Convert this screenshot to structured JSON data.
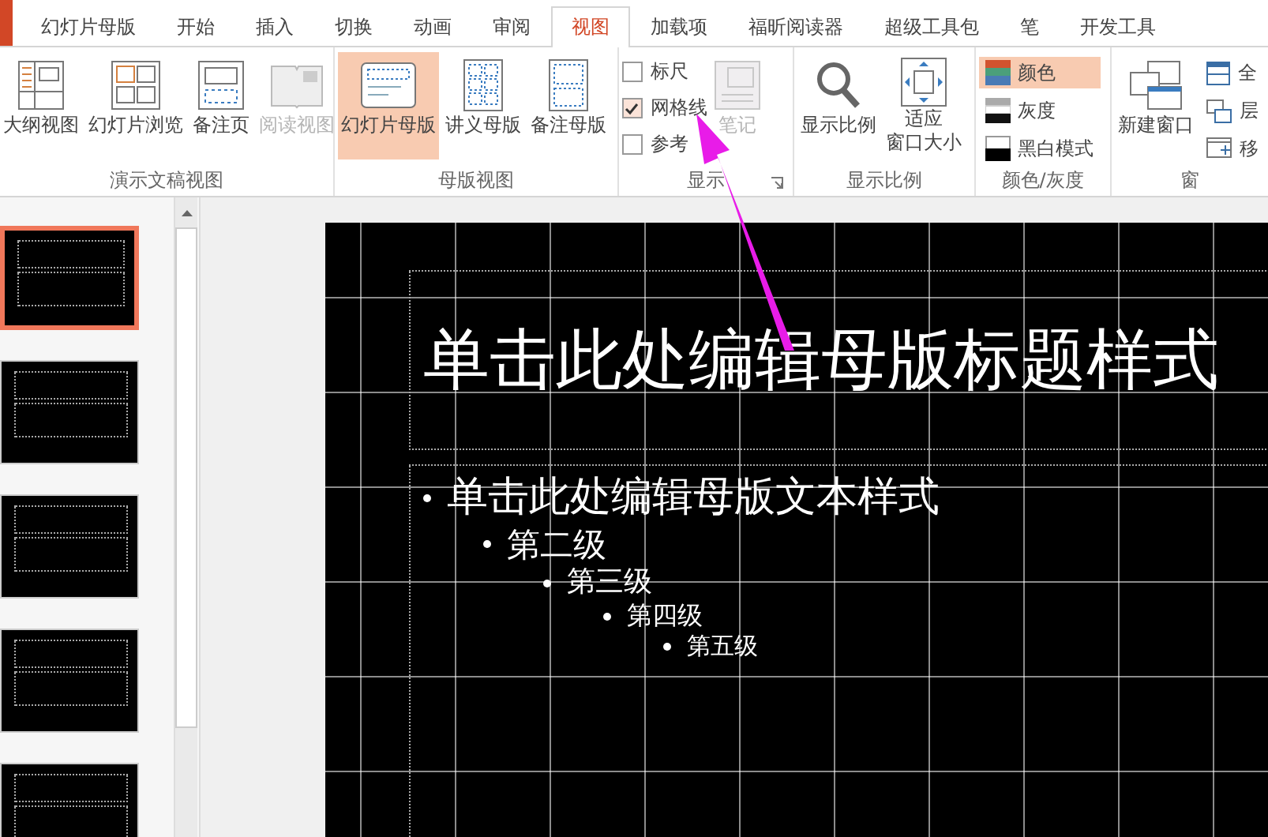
{
  "tabs": [
    {
      "label": "幻灯片母版",
      "selected": false
    },
    {
      "label": "开始",
      "selected": false
    },
    {
      "label": "插入",
      "selected": false
    },
    {
      "label": "切换",
      "selected": false
    },
    {
      "label": "动画",
      "selected": false
    },
    {
      "label": "审阅",
      "selected": false
    },
    {
      "label": "视图",
      "selected": true
    },
    {
      "label": "加载项",
      "selected": false
    },
    {
      "label": "福昕阅读器",
      "selected": false
    },
    {
      "label": "超级工具包",
      "selected": false
    },
    {
      "label": "笔",
      "selected": false
    },
    {
      "label": "开发工具",
      "selected": false
    }
  ],
  "ribbon": {
    "groups": [
      {
        "label": "演示文稿视图",
        "items": [
          {
            "kind": "large",
            "label": "大纲视图",
            "disabled": false,
            "selected": false
          },
          {
            "kind": "large",
            "label": "幻灯片浏览",
            "disabled": false,
            "selected": false
          },
          {
            "kind": "large",
            "label": "备注页",
            "disabled": false,
            "selected": false
          },
          {
            "kind": "large",
            "label": "阅读视图",
            "disabled": true,
            "selected": false
          }
        ]
      },
      {
        "label": "母版视图",
        "items": [
          {
            "kind": "large",
            "label": "幻灯片母版",
            "disabled": false,
            "selected": true
          },
          {
            "kind": "large",
            "label": "讲义母版",
            "disabled": false,
            "selected": false
          },
          {
            "kind": "large",
            "label": "备注母版",
            "disabled": false,
            "selected": false
          }
        ]
      },
      {
        "label": "显示",
        "launcher": true,
        "items": [
          {
            "kind": "check",
            "label": "标尺",
            "checked": false
          },
          {
            "kind": "check",
            "label": "网格线",
            "checked": true
          },
          {
            "kind": "check",
            "label": "参考",
            "checked": false
          },
          {
            "kind": "large",
            "label": "笔记",
            "disabled": true,
            "selected": false
          }
        ]
      },
      {
        "label": "显示比例",
        "items": [
          {
            "kind": "large",
            "label": "显示比例",
            "disabled": false,
            "selected": false
          },
          {
            "kind": "large",
            "label_lines": [
              "适应",
              "窗口大小"
            ],
            "disabled": false,
            "selected": false
          }
        ]
      },
      {
        "label": "颜色/灰度",
        "items": [
          {
            "kind": "small",
            "label": "颜色",
            "selected": true
          },
          {
            "kind": "small",
            "label": "灰度",
            "selected": false
          },
          {
            "kind": "small",
            "label": "黑白模式",
            "selected": false
          }
        ]
      },
      {
        "label": "窗",
        "items": [
          {
            "kind": "large",
            "label": "新建窗口",
            "disabled": false,
            "selected": false
          },
          {
            "kind": "small",
            "label": "全",
            "selected": false
          },
          {
            "kind": "small",
            "label": "层",
            "selected": false
          },
          {
            "kind": "small",
            "label": "移",
            "selected": false
          }
        ]
      }
    ]
  },
  "thumbnails": [
    {
      "selected": true
    },
    {
      "selected": false
    },
    {
      "selected": false
    },
    {
      "selected": false
    },
    {
      "selected": false
    }
  ],
  "slide": {
    "title": "单击此处编辑母版标题样式",
    "outline": [
      {
        "text": "单击此处编辑母版文本样式",
        "children": [
          {
            "text": "第二级",
            "children": [
              {
                "text": "第三级",
                "children": [
                  {
                    "text": "第四级",
                    "children": [
                      {
                        "text": "第五级"
                      }
                    ]
                  }
                ]
              }
            ]
          }
        ]
      }
    ]
  }
}
